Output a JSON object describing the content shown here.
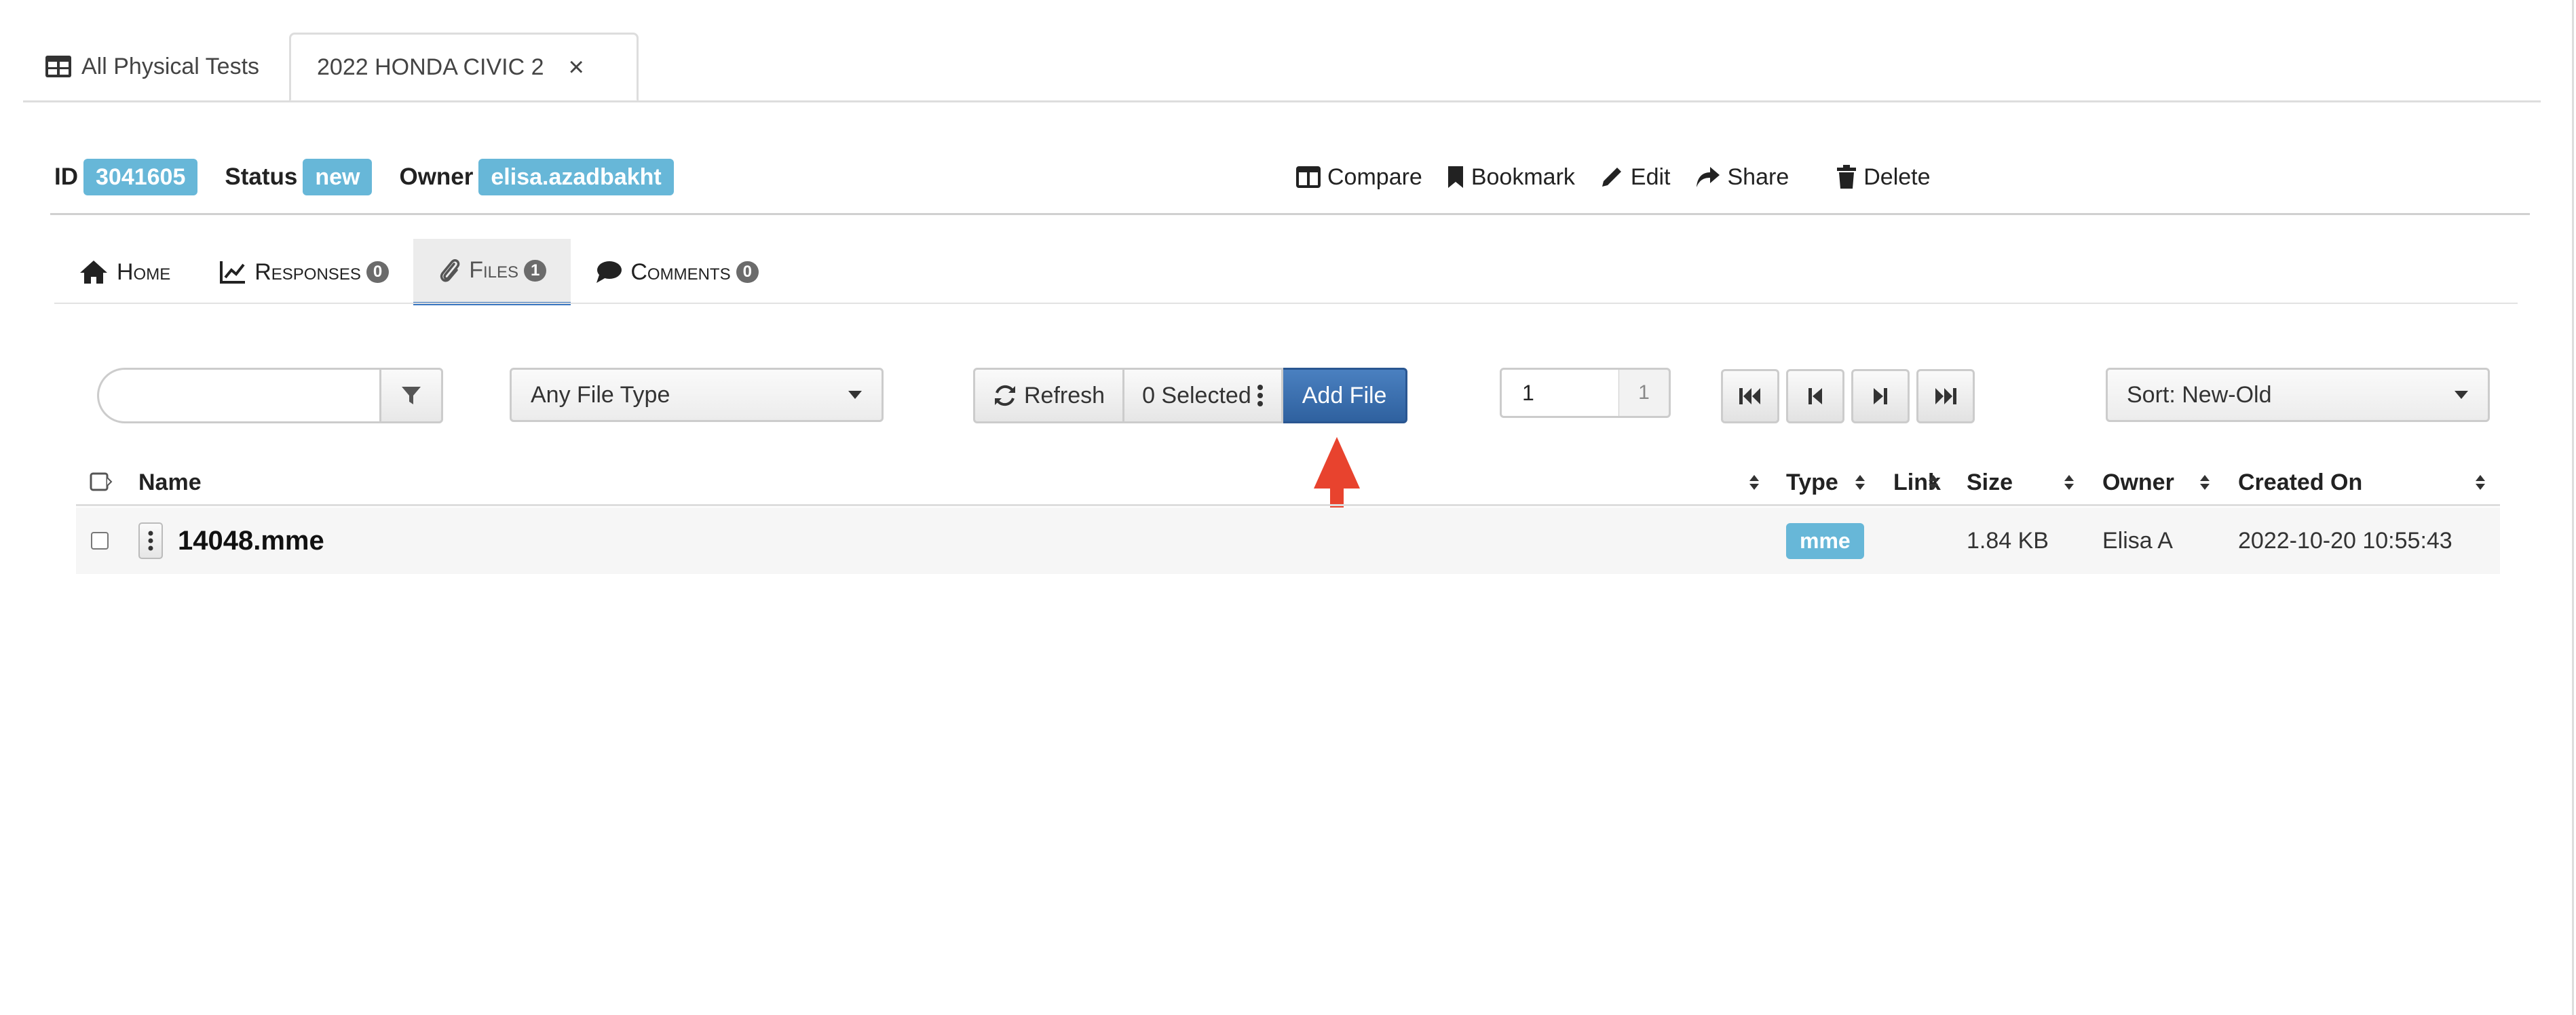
{
  "top_tabs": {
    "all_tests": "All Physical Tests",
    "current": "2022 HONDA CIVIC 2",
    "close": "×"
  },
  "info": {
    "id_label": "ID",
    "id_value": "3041605",
    "status_label": "Status",
    "status_value": "new",
    "owner_label": "Owner",
    "owner_value": "elisa.azadbakht"
  },
  "actions": {
    "compare": "Compare",
    "bookmark": "Bookmark",
    "edit": "Edit",
    "share": "Share",
    "delete": "Delete"
  },
  "sub_tabs": [
    {
      "label": "Home"
    },
    {
      "label": "Responses",
      "count": "0"
    },
    {
      "label": "Files",
      "count": "1"
    },
    {
      "label": "Comments",
      "count": "0"
    }
  ],
  "toolbar": {
    "search_value": "",
    "file_type": "Any File Type",
    "refresh": "Refresh",
    "selected": "0 Selected",
    "add_file": "Add File",
    "page_value": "1",
    "page_total": "1",
    "sort": "Sort: New-Old"
  },
  "table": {
    "headers": [
      "Name",
      "Type",
      "Link",
      "Size",
      "Owner",
      "Created On"
    ],
    "rows": [
      {
        "name": "14048.mme",
        "type": "mme",
        "link": "",
        "size": "1.84 KB",
        "owner": "Elisa A",
        "created": "2022-10-20 10:55:43"
      }
    ]
  },
  "colors": {
    "badge": "#67b7d8",
    "primary_button": "#2f619f",
    "active_tab_underline": "#3a77c0",
    "annotation_arrow": "#e8432e"
  },
  "icons": [
    "table-icon",
    "close-icon",
    "columns-icon",
    "bookmark-icon",
    "pencil-icon",
    "share-icon",
    "trash-icon",
    "home-icon",
    "line-chart-icon",
    "paperclip-icon",
    "comment-icon",
    "filter-icon",
    "caret-down-icon",
    "refresh-icon",
    "vertical-dots-icon",
    "first-page-icon",
    "prev-page-icon",
    "next-page-icon",
    "last-page-icon",
    "sort-icon",
    "checkbox-icon"
  ]
}
